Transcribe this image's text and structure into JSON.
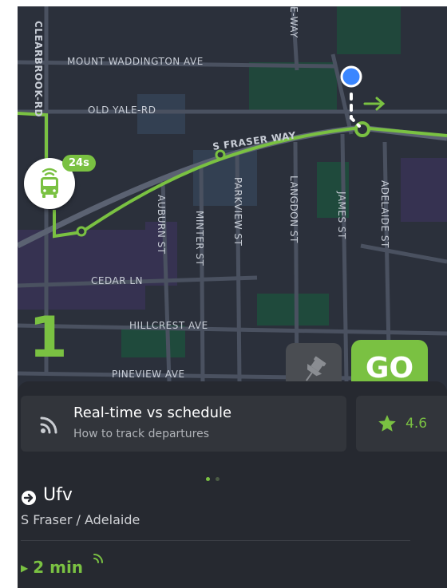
{
  "colors": {
    "accent": "#7ac142",
    "map_bg": "#2a2f3a",
    "sheet_bg": "#262930",
    "card_bg": "#32353b"
  },
  "map": {
    "street_labels": {
      "clearbrook": "CLEARBROOK-RD",
      "mount_waddington": "MOUNT WADDINGTON AVE",
      "old_yale": "OLD YALE-RD",
      "s_fraser_way": "S FRASER WAY",
      "auburn": "AUBURN ST",
      "minter": "MINTER ST",
      "parkview": "PARKVIEW ST",
      "langdon": "LANGDON ST",
      "james": "JAMES ST",
      "adelaide": "ADELAIDE ST",
      "cedar": "CEDAR LN",
      "hillcrest": "HILLCREST AVE",
      "pineview": "PINEVIEW AVE",
      "top_way": "E-WAY"
    }
  },
  "route": {
    "number": "1",
    "bus_time_badge": "24s",
    "bus_icon": "bus-icon"
  },
  "actions": {
    "pin_icon": "pin-icon",
    "go_label": "GO"
  },
  "cards": [
    {
      "icon": "realtime-signal-icon",
      "title": "Real-time vs schedule",
      "subtitle": "How to track departures"
    },
    {
      "icon": "star-icon",
      "label": "4.6"
    }
  ],
  "pager": {
    "count": 2,
    "active": 1
  },
  "destination": {
    "icon": "arrow-circle-icon",
    "name": "Ufv",
    "stop": "S Fraser / Adelaide"
  },
  "departure": {
    "eta": "2 min",
    "icon": "realtime-signal-icon"
  }
}
